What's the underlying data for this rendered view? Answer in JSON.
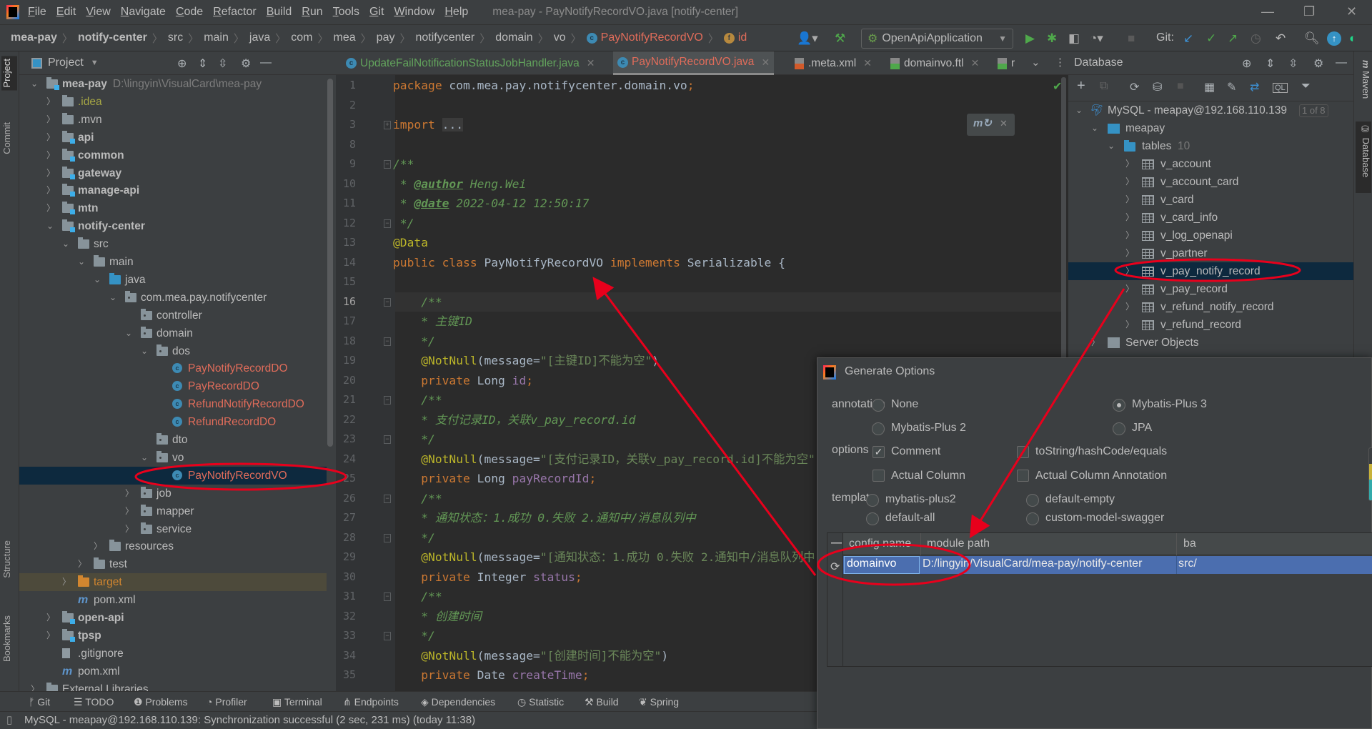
{
  "window": {
    "title": "mea-pay - PayNotifyRecordVO.java [notify-center]",
    "menu": [
      "File",
      "Edit",
      "View",
      "Navigate",
      "Code",
      "Refactor",
      "Build",
      "Run",
      "Tools",
      "Git",
      "Window",
      "Help"
    ]
  },
  "breadcrumb": [
    "mea-pay",
    "notify-center",
    "src",
    "main",
    "java",
    "com",
    "mea",
    "pay",
    "notifycenter",
    "domain",
    "vo",
    "PayNotifyRecordVO",
    "id"
  ],
  "toolbar": {
    "run_config": "OpenApiApplication",
    "git_label": "Git:"
  },
  "left_stripe": [
    "Project",
    "Commit",
    "Structure",
    "Bookmarks"
  ],
  "right_stripe": [
    "Maven",
    "Database"
  ],
  "project": {
    "title": "Project",
    "tree": [
      {
        "d": 0,
        "a": "open",
        "i": "module",
        "t": "mea-pay",
        "s": "bold",
        "h": "D:\\lingyin\\VisualCard\\mea-pay"
      },
      {
        "d": 1,
        "a": "closed",
        "i": "folder",
        "t": ".idea",
        "s": "idea"
      },
      {
        "d": 1,
        "a": "closed",
        "i": "folder",
        "t": ".mvn",
        "s": ""
      },
      {
        "d": 1,
        "a": "closed",
        "i": "module",
        "t": "api",
        "s": "bold"
      },
      {
        "d": 1,
        "a": "closed",
        "i": "module",
        "t": "common",
        "s": "bold"
      },
      {
        "d": 1,
        "a": "closed",
        "i": "module",
        "t": "gateway",
        "s": "bold"
      },
      {
        "d": 1,
        "a": "closed",
        "i": "module",
        "t": "manage-api",
        "s": "bold"
      },
      {
        "d": 1,
        "a": "closed",
        "i": "module",
        "t": "mtn",
        "s": "bold"
      },
      {
        "d": 1,
        "a": "open",
        "i": "module",
        "t": "notify-center",
        "s": "bold"
      },
      {
        "d": 2,
        "a": "open",
        "i": "folder",
        "t": "src",
        "s": ""
      },
      {
        "d": 3,
        "a": "open",
        "i": "folder",
        "t": "main",
        "s": ""
      },
      {
        "d": 4,
        "a": "open",
        "i": "srcf",
        "t": "java",
        "s": ""
      },
      {
        "d": 5,
        "a": "open",
        "i": "pkg",
        "t": "com.mea.pay.notifycenter",
        "s": ""
      },
      {
        "d": 6,
        "a": "none",
        "i": "pkg",
        "t": "controller",
        "s": ""
      },
      {
        "d": 6,
        "a": "open",
        "i": "pkg",
        "t": "domain",
        "s": ""
      },
      {
        "d": 7,
        "a": "open",
        "i": "pkg",
        "t": "dos",
        "s": ""
      },
      {
        "d": 8,
        "a": "none",
        "i": "cls",
        "t": "PayNotifyRecordDO",
        "s": "red"
      },
      {
        "d": 8,
        "a": "none",
        "i": "cls",
        "t": "PayRecordDO",
        "s": "red"
      },
      {
        "d": 8,
        "a": "none",
        "i": "cls",
        "t": "RefundNotifyRecordDO",
        "s": "red"
      },
      {
        "d": 8,
        "a": "none",
        "i": "cls",
        "t": "RefundRecordDO",
        "s": "red"
      },
      {
        "d": 7,
        "a": "none",
        "i": "pkg",
        "t": "dto",
        "s": ""
      },
      {
        "d": 7,
        "a": "open",
        "i": "pkg",
        "t": "vo",
        "s": ""
      },
      {
        "d": 8,
        "a": "none",
        "i": "cls",
        "t": "PayNotifyRecordVO",
        "s": "red",
        "sel": true
      },
      {
        "d": 6,
        "a": "closed",
        "i": "pkg",
        "t": "job",
        "s": ""
      },
      {
        "d": 6,
        "a": "closed",
        "i": "pkg",
        "t": "mapper",
        "s": ""
      },
      {
        "d": 6,
        "a": "closed",
        "i": "pkg",
        "t": "service",
        "s": ""
      },
      {
        "d": 4,
        "a": "closed",
        "i": "folder",
        "t": "resources",
        "s": ""
      },
      {
        "d": 3,
        "a": "closed",
        "i": "folder",
        "t": "test",
        "s": ""
      },
      {
        "d": 2,
        "a": "closed",
        "i": "exclf",
        "t": "target",
        "s": "orange",
        "excl": true
      },
      {
        "d": 2,
        "a": "none",
        "i": "mvn",
        "t": "pom.xml",
        "s": ""
      },
      {
        "d": 1,
        "a": "closed",
        "i": "module",
        "t": "open-api",
        "s": "bold"
      },
      {
        "d": 1,
        "a": "closed",
        "i": "module",
        "t": "tpsp",
        "s": "bold"
      },
      {
        "d": 1,
        "a": "none",
        "i": "gitf",
        "t": ".gitignore",
        "s": ""
      },
      {
        "d": 1,
        "a": "none",
        "i": "mvn",
        "t": "pom.xml",
        "s": ""
      },
      {
        "d": 0,
        "a": "closed",
        "i": "folder",
        "t": "External Libraries",
        "s": ""
      }
    ]
  },
  "editor_tabs": [
    {
      "label": "UpdateFailNotificationStatusJobHandler.java",
      "icon": "class-icon",
      "color": "#62a35c"
    },
    {
      "label": "PayNotifyRecordVO.java",
      "icon": "class-icon",
      "color": "#e06c5a",
      "active": true
    },
    {
      "label": ".meta.xml",
      "icon": "xml-file-icon",
      "color": "#bbbbbb"
    },
    {
      "label": "domainvo.ftl",
      "icon": "ftl-file-icon",
      "color": "#bbbbbb"
    },
    {
      "label": "r",
      "icon": "ftl-file-icon",
      "color": "#bbbbbb"
    }
  ],
  "code": [
    {
      "n": "1",
      "s": [
        [
          "kw",
          "package"
        ],
        [
          "pl",
          " com.mea.pay.notifycenter.domain.vo"
        ],
        [
          "kw",
          ";"
        ]
      ]
    },
    {
      "n": "2",
      "s": []
    },
    {
      "n": "3",
      "s": [
        [
          "kw",
          "import"
        ],
        [
          "pl",
          " "
        ],
        [
          "fo",
          "..."
        ]
      ],
      "f": "+"
    },
    {
      "n": "8",
      "s": []
    },
    {
      "n": "9",
      "s": [
        [
          "cm",
          "/**"
        ]
      ],
      "f": "-"
    },
    {
      "n": "10",
      "s": [
        [
          "cm",
          " * "
        ],
        [
          "tag",
          "@author"
        ],
        [
          "cm",
          " Heng.Wei"
        ]
      ]
    },
    {
      "n": "11",
      "s": [
        [
          "cm",
          " * "
        ],
        [
          "tag",
          "@date"
        ],
        [
          "cm",
          " 2022-04-12 12:50:17"
        ]
      ]
    },
    {
      "n": "12",
      "s": [
        [
          "cm",
          " */"
        ]
      ],
      "f": "-"
    },
    {
      "n": "13",
      "s": [
        [
          "an",
          "@Data"
        ]
      ]
    },
    {
      "n": "14",
      "s": [
        [
          "kw",
          "public class "
        ],
        [
          "pl",
          "PayNotifyRecordVO "
        ],
        [
          "kw",
          "implements "
        ],
        [
          "pl",
          "Serializable {"
        ]
      ]
    },
    {
      "n": "15",
      "s": []
    },
    {
      "n": "16",
      "s": [
        [
          "cm",
          "    /**"
        ]
      ],
      "f": "-",
      "cur": true
    },
    {
      "n": "17",
      "s": [
        [
          "cm",
          "    * 主键ID"
        ]
      ]
    },
    {
      "n": "18",
      "s": [
        [
          "cm",
          "    */"
        ]
      ],
      "f": "-"
    },
    {
      "n": "19",
      "s": [
        [
          "pl",
          "    "
        ],
        [
          "an",
          "@NotNull"
        ],
        [
          "pl",
          "(message="
        ],
        [
          "st",
          "\"[主键ID]不能为空\""
        ],
        [
          "pl",
          ")"
        ]
      ]
    },
    {
      "n": "20",
      "s": [
        [
          "pl",
          "    "
        ],
        [
          "kw",
          "private "
        ],
        [
          "pl",
          "Long "
        ],
        [
          "fd",
          "id"
        ],
        [
          "kw",
          ";"
        ]
      ]
    },
    {
      "n": "21",
      "s": [
        [
          "cm",
          "    /**"
        ]
      ],
      "f": "-"
    },
    {
      "n": "22",
      "s": [
        [
          "cm",
          "    * 支付记录ID，关联v_pay_record.id"
        ]
      ]
    },
    {
      "n": "23",
      "s": [
        [
          "cm",
          "    */"
        ]
      ],
      "f": "-"
    },
    {
      "n": "24",
      "s": [
        [
          "pl",
          "    "
        ],
        [
          "an",
          "@NotNull"
        ],
        [
          "pl",
          "(message="
        ],
        [
          "st",
          "\"[支付记录ID，关联v_pay_record.id]不能为空\""
        ]
      ]
    },
    {
      "n": "25",
      "s": [
        [
          "pl",
          "    "
        ],
        [
          "kw",
          "private "
        ],
        [
          "pl",
          "Long "
        ],
        [
          "fd",
          "payRecordId"
        ],
        [
          "kw",
          ";"
        ]
      ]
    },
    {
      "n": "26",
      "s": [
        [
          "cm",
          "    /**"
        ]
      ],
      "f": "-"
    },
    {
      "n": "27",
      "s": [
        [
          "cm",
          "    * 通知状态：1.成功 0.失败 2.通知中/消息队列中"
        ]
      ]
    },
    {
      "n": "28",
      "s": [
        [
          "cm",
          "    */"
        ]
      ],
      "f": "-"
    },
    {
      "n": "29",
      "s": [
        [
          "pl",
          "    "
        ],
        [
          "an",
          "@NotNull"
        ],
        [
          "pl",
          "(message="
        ],
        [
          "st",
          "\"[通知状态：1.成功 0.失败 2.通知中/消息队列中"
        ]
      ]
    },
    {
      "n": "30",
      "s": [
        [
          "pl",
          "    "
        ],
        [
          "kw",
          "private "
        ],
        [
          "pl",
          "Integer "
        ],
        [
          "fd",
          "status"
        ],
        [
          "kw",
          ";"
        ]
      ]
    },
    {
      "n": "31",
      "s": [
        [
          "cm",
          "    /**"
        ]
      ],
      "f": "-"
    },
    {
      "n": "32",
      "s": [
        [
          "cm",
          "    * 创建时间"
        ]
      ]
    },
    {
      "n": "33",
      "s": [
        [
          "cm",
          "    */"
        ]
      ],
      "f": "-"
    },
    {
      "n": "34",
      "s": [
        [
          "pl",
          "    "
        ],
        [
          "an",
          "@NotNull"
        ],
        [
          "pl",
          "(message="
        ],
        [
          "st",
          "\"[创建时间]不能为空\""
        ],
        [
          "pl",
          ")"
        ]
      ]
    },
    {
      "n": "35",
      "s": [
        [
          "pl",
          "    "
        ],
        [
          "kw",
          "private "
        ],
        [
          "pl",
          "Date "
        ],
        [
          "fd",
          "createTime"
        ],
        [
          "kw",
          ";"
        ]
      ]
    }
  ],
  "database": {
    "title": "Database",
    "connection": "MySQL - meapay@192.168.110.139",
    "connection_badge": "1 of 8",
    "schema": "meapay",
    "tables_label": "tables",
    "tables_count": "10",
    "tables": [
      "v_account",
      "v_account_card",
      "v_card",
      "v_card_info",
      "v_log_openapi",
      "v_partner",
      "v_pay_notify_record",
      "v_pay_record",
      "v_refund_notify_record",
      "v_refund_record"
    ],
    "selected_table": "v_pay_notify_record",
    "server_objects": "Server Objects"
  },
  "dialog": {
    "title": "Generate Options",
    "annotation_label": "annotation",
    "annotation_options": [
      {
        "label": "None",
        "selected": false
      },
      {
        "label": "Mybatis-Plus 3",
        "selected": true
      },
      {
        "label": "Mybatis-Plus 2",
        "selected": false
      },
      {
        "label": "JPA",
        "selected": false
      }
    ],
    "options_label": "options",
    "checkboxes": [
      {
        "label": "Comment",
        "checked": true
      },
      {
        "label": "toString/hashCode/equals",
        "checked": false
      },
      {
        "label": "Actual Column",
        "checked": false
      },
      {
        "label": "Actual Column Annotation",
        "checked": false
      }
    ],
    "template_label": "template",
    "templates": [
      {
        "label": "mybatis-plus2",
        "selected": false
      },
      {
        "label": "default-empty",
        "selected": false
      },
      {
        "label": "default-all",
        "selected": false
      },
      {
        "label": "custom-model-swagger",
        "selected": false
      }
    ],
    "table": {
      "columns": [
        "config name",
        "module path",
        "ba"
      ],
      "rows": [
        [
          "domainvo",
          "D:/lingyin/VisualCard/mea-pay/notify-center",
          "src/"
        ]
      ]
    }
  },
  "bottom_tools": [
    "Git",
    "TODO",
    "Problems",
    "Profiler",
    "Terminal",
    "Endpoints",
    "Dependencies",
    "Statistic",
    "Build",
    "Spring"
  ],
  "status": "MySQL - meapay@192.168.110.139: Synchronization successful (2 sec, 231 ms) (today 11:38)",
  "annotation_color": "#e8001c"
}
